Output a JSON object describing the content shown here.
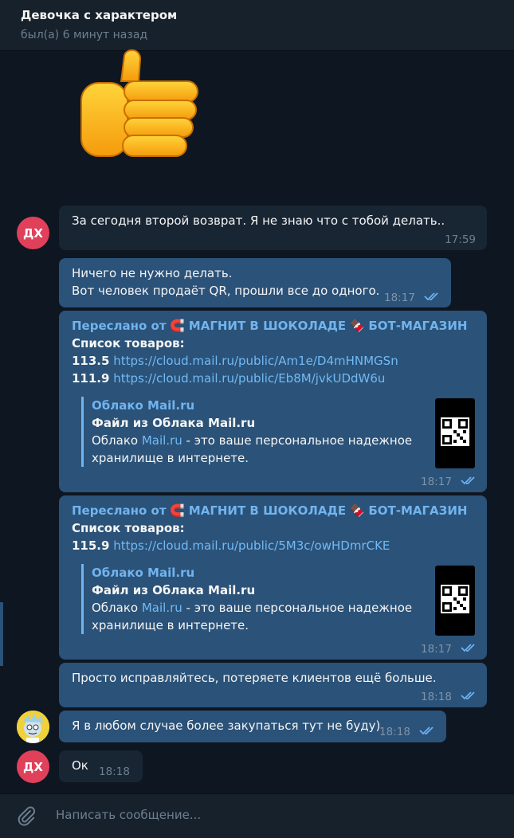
{
  "header": {
    "title": "Девочка с характером",
    "status": "был(а) 6 минут назад"
  },
  "avatars": {
    "dh": "ДХ"
  },
  "messages": {
    "m1": {
      "text": "За сегодня второй возврат. Я не знаю что с тобой делать..",
      "time": "17:59"
    },
    "m2": {
      "line1": "Ничего не нужно делать.",
      "line2": "Вот человек продаёт QR, прошли все до одного.",
      "time": "18:17"
    },
    "m3": {
      "fwd_prefix": "Переслано от",
      "fwd_name1": "МАГНИТ В ШОКОЛАДЕ",
      "fwd_name2": "БОТ-МАГАЗИН",
      "list_title": "Список товаров:",
      "item1_num": "113.5",
      "item1_link": "https://cloud.mail.ru/public/Am1e/D4mHNMGSn",
      "item2_num": "111.9",
      "item2_link": "https://cloud.mail.ru/public/Eb8M/jvkUDdW6u",
      "preview_site": "Облако Mail.ru",
      "preview_title": "Файл из Облака Mail.ru",
      "preview_desc1_a": "Облако ",
      "preview_desc1_link": "Mail.ru",
      "preview_desc1_b": " - это ваше персональное надежное",
      "preview_desc2": "хранилище в интернете.",
      "time": "18:17"
    },
    "m4": {
      "fwd_prefix": "Переслано от",
      "fwd_name1": "МАГНИТ В ШОКОЛАДЕ",
      "fwd_name2": "БОТ-МАГАЗИН",
      "list_title": "Список товаров:",
      "item1_num": "115.9",
      "item1_link": "https://cloud.mail.ru/public/5M3c/owHDmrCKE",
      "preview_site": "Облако Mail.ru",
      "preview_title": "Файл из Облака Mail.ru",
      "preview_desc1_a": "Облако ",
      "preview_desc1_link": "Mail.ru",
      "preview_desc1_b": " - это ваше персональное надежное",
      "preview_desc2": "хранилище в интернете.",
      "time": "18:17"
    },
    "m5": {
      "text": "Просто исправляйтесь, потеряете клиентов ещё больше.",
      "time": "18:18"
    },
    "m6": {
      "text": "Я в любом случае более закупаться тут не буду)",
      "time": "18:18"
    },
    "m7": {
      "text": "Ок",
      "time": "18:18"
    }
  },
  "composer": {
    "placeholder": "Написать сообщение..."
  },
  "colors": {
    "background": "#0e1621",
    "incoming": "#182533",
    "outgoing": "#2b5278",
    "link": "#71baf6",
    "avatar": "#e0405a"
  }
}
